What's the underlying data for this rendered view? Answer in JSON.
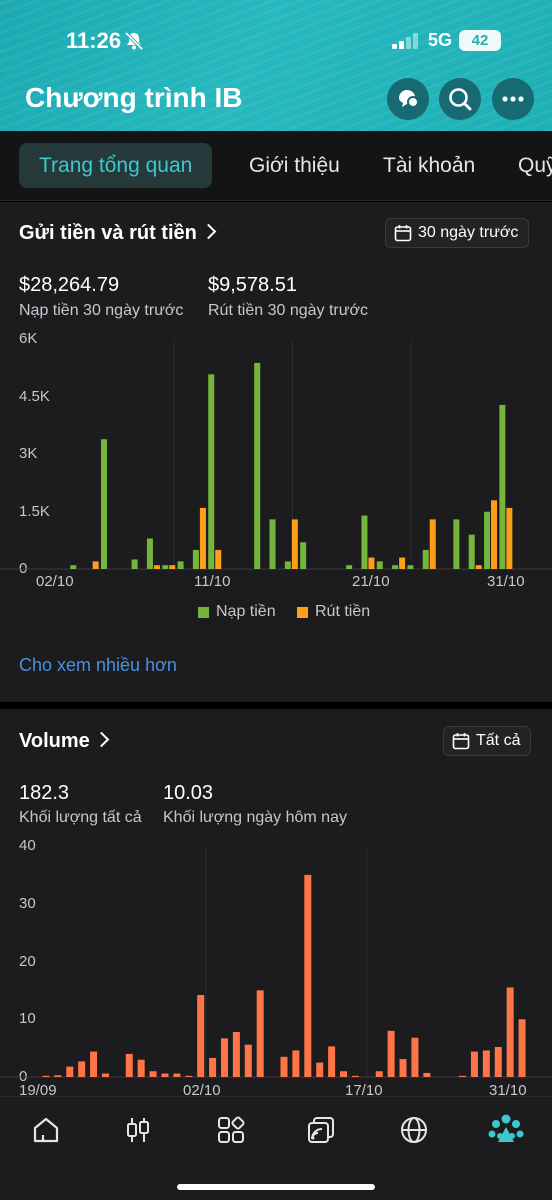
{
  "status_bar": {
    "time": "11:26",
    "network": "5G",
    "battery": "42"
  },
  "header": {
    "title": "Chương trình IB"
  },
  "tabs": [
    {
      "label": "Trang tổng quan",
      "active": true
    },
    {
      "label": "Giới thiệu"
    },
    {
      "label": "Tài khoản"
    },
    {
      "label": "Quỹ"
    }
  ],
  "deposits": {
    "title": "Gửi tiền và rút tiền",
    "period_label": "30 ngày trước",
    "deposit_value": "$28,264.79",
    "deposit_label": "Nạp tiền 30 ngày trước",
    "withdraw_value": "$9,578.51",
    "withdraw_label": "Rút tiền 30 ngày trước",
    "show_more": "Cho xem nhiều hơn"
  },
  "volume": {
    "title": "Volume",
    "period_label": "Tất cả",
    "total_value": "182.3",
    "total_label": "Khối lượng tất cả",
    "today_value": "10.03",
    "today_label": "Khối lượng ngày hôm nay"
  },
  "colors": {
    "accent": "#3cc8cc",
    "deposit": "#74b63b",
    "withdraw": "#ff9e1b",
    "volume": "#ff7548",
    "link": "#4a90e2"
  },
  "chart_data": [
    {
      "type": "bar",
      "title": "",
      "ylim": [
        0,
        6000
      ],
      "yticks": [
        0,
        1500,
        3000,
        4500,
        6000
      ],
      "yticklabels": [
        "0",
        "1.5K",
        "3K",
        "4.5K",
        "6K"
      ],
      "xticklabels": [
        "02/10",
        "11/10",
        "21/10",
        "31/10"
      ],
      "legend": "bottom",
      "series": [
        {
          "name": "Nạp tiền",
          "values": [
            0,
            100,
            0,
            3400,
            0,
            250,
            800,
            100,
            200,
            500,
            5100,
            0,
            0,
            5400,
            1300,
            200,
            700,
            0,
            0,
            100,
            1400,
            200,
            100,
            100,
            500,
            0,
            1300,
            900,
            1500,
            4300,
            0
          ]
        },
        {
          "name": "Rút tiền",
          "values": [
            0,
            0,
            200,
            0,
            0,
            0,
            100,
            100,
            0,
            1600,
            500,
            0,
            0,
            0,
            0,
            1300,
            0,
            0,
            0,
            0,
            300,
            0,
            300,
            0,
            1300,
            0,
            0,
            100,
            1800,
            1600,
            0
          ]
        }
      ]
    },
    {
      "type": "bar",
      "title": "",
      "ylim": [
        0,
        40
      ],
      "yticks": [
        0,
        10,
        20,
        30,
        40
      ],
      "yticklabels": [
        "0",
        "10",
        "20",
        "30",
        "40"
      ],
      "xticklabels": [
        "19/09",
        "02/10",
        "17/10",
        "31/10"
      ],
      "series": [
        {
          "name": "",
          "values": [
            0.2,
            0.3,
            1.8,
            2.7,
            4.4,
            0.6,
            0,
            4,
            3,
            1,
            0.6,
            0.6,
            0.2,
            14.2,
            3.3,
            6.7,
            7.8,
            5.6,
            15,
            0,
            3.5,
            4.6,
            35,
            2.5,
            5.3,
            1,
            0.2,
            0,
            1,
            8,
            3.1,
            6.8,
            0.7,
            0,
            0,
            0.2,
            4.4,
            4.6,
            5.2,
            15.5,
            10
          ]
        }
      ]
    }
  ]
}
